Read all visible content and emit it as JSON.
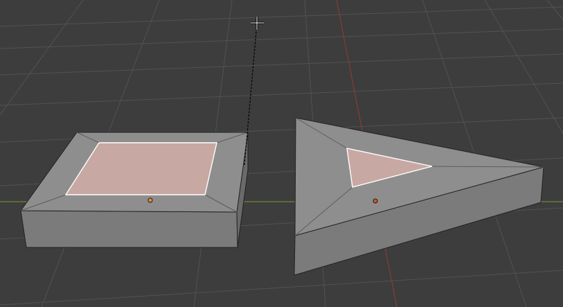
{
  "viewport": {
    "background": "#3d3d3d",
    "grid_color": "#525252",
    "x_axis_color": "#6b8a3a",
    "y_axis_color": "#8a3a3a"
  },
  "cursor": {
    "icon": "crosshair-cursor-icon",
    "color": "#ffffff",
    "stroke": "#000000"
  },
  "transform_line": {
    "style": "dashed",
    "color": "#000000"
  },
  "objects": [
    {
      "name": "square-frame-mesh",
      "shape": "square-inset-extruded",
      "face_color": "#8a8a8a",
      "side_color": "#7e7e7e",
      "bevel_color": "#8f8f8f",
      "selected_face_color": "#c8a8a2",
      "selected_edge_color": "#ffffff",
      "origin_color": "#e8902a"
    },
    {
      "name": "triangle-frame-mesh",
      "shape": "triangle-inset-extruded",
      "face_color": "#8a8a8a",
      "side_color": "#7e7e7e",
      "bevel_color": "#8f8f8f",
      "selected_face_color": "#c8a8a2",
      "selected_edge_color": "#ffffff",
      "origin_color": "#d9541f"
    }
  ]
}
